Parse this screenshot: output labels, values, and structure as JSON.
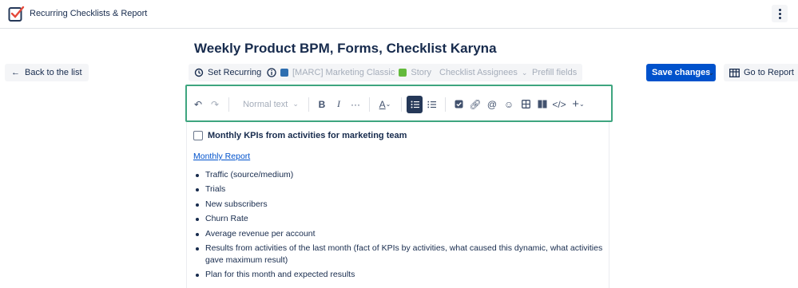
{
  "app": {
    "title": "Recurring Checklists & Report"
  },
  "page": {
    "title": "Weekly Product BPM, Forms, Checklist Karyna"
  },
  "nav": {
    "back_label": "Back to the list"
  },
  "actions": {
    "set_recurring": "Set Recurring",
    "project": "[MARC] Marketing Classic",
    "issue_type": "Story",
    "checklist_assignees": "Checklist Assignees",
    "prefill": "Prefill fields",
    "save": "Save changes",
    "go_report": "Go to Report"
  },
  "toolbar": {
    "text_style": "Normal text"
  },
  "content": {
    "task": "Monthly KPIs from activities for marketing team",
    "link": "Monthly Report",
    "bullets": [
      "Traffic (source/medium)",
      "Trials",
      "New subscribers",
      "Churn Rate",
      "Average revenue per account",
      "Results from activities of the last month (fact of KPIs by activities, what caused this dynamic, what activities gave maximum result)",
      "Plan for this month and expected results"
    ]
  },
  "colors": {
    "primary": "#0052cc",
    "highlight": "#3ea57f",
    "story": "#63ba3c"
  }
}
